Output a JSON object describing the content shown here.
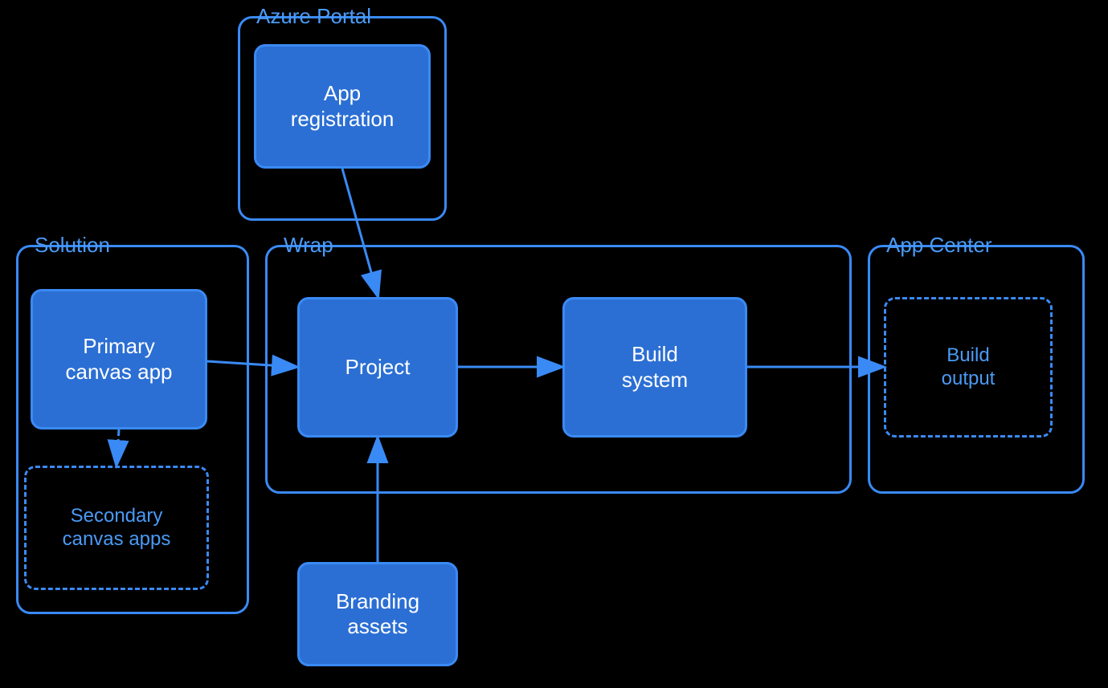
{
  "diagram": {
    "background": "#000000",
    "groups": {
      "azure_portal": {
        "label": "Azure Portal"
      },
      "solution": {
        "label": "Solution"
      },
      "wrap": {
        "label": "Wrap"
      },
      "app_center": {
        "label": "App Center"
      }
    },
    "boxes": {
      "app_registration": {
        "label": "App\nregistration"
      },
      "primary_canvas_app": {
        "label": "Primary\ncanvas app"
      },
      "secondary_canvas_apps": {
        "label": "Secondary\ncanvas apps"
      },
      "project": {
        "label": "Project"
      },
      "build_system": {
        "label": "Build\nsystem"
      },
      "build_output": {
        "label": "Build\noutput"
      },
      "branding_assets": {
        "label": "Branding\nassets"
      }
    }
  }
}
